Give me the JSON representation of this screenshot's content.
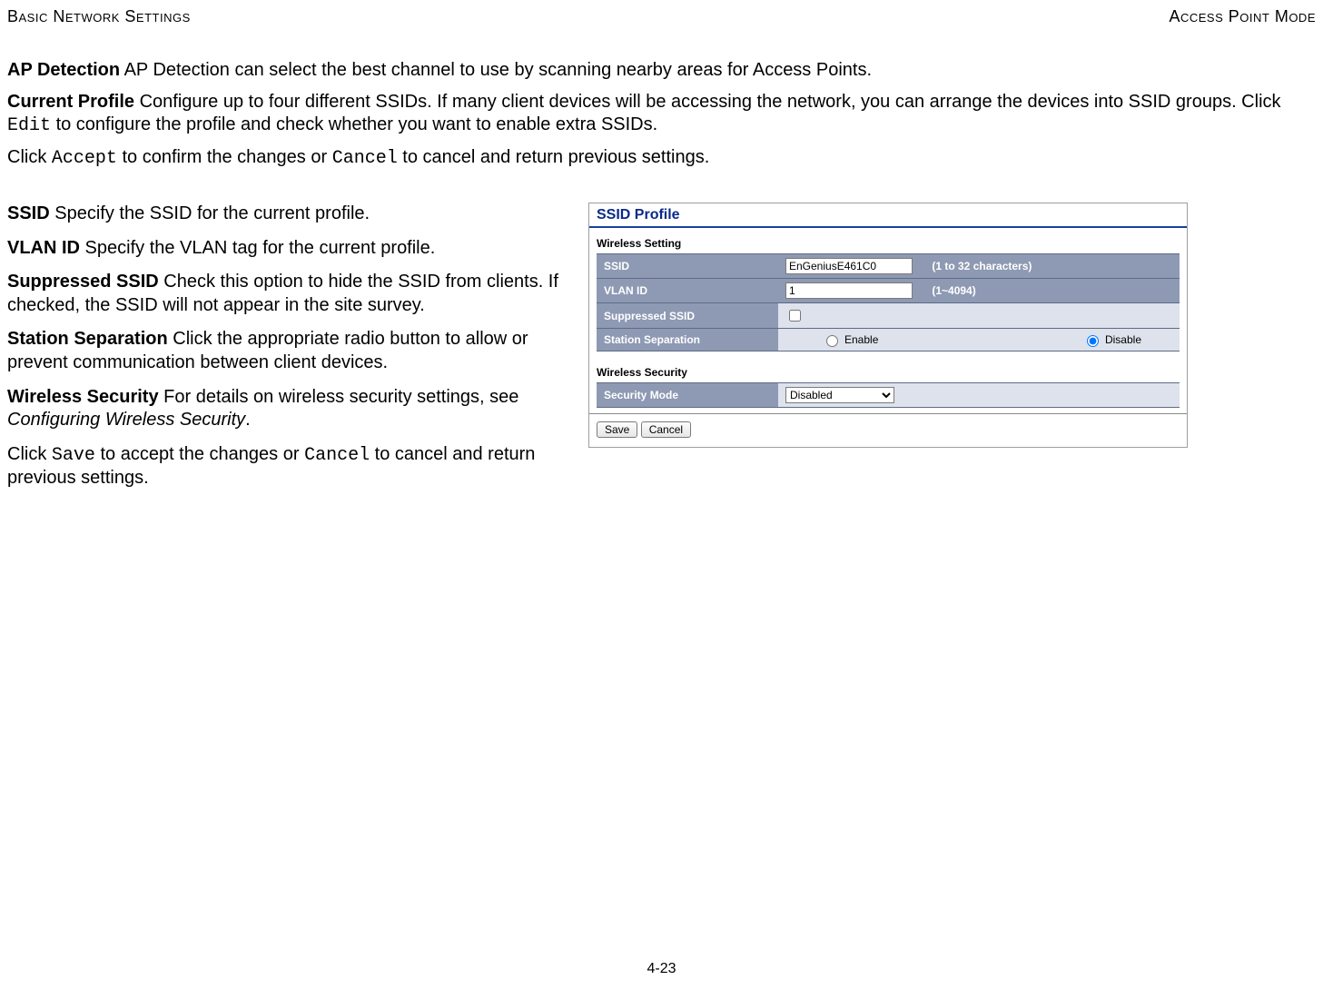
{
  "header": {
    "left": "Basic Network Settings",
    "right": "Access Point Mode"
  },
  "intro": {
    "ap_detection_label": "AP Detection",
    "ap_detection_text": "  AP Detection can select the best channel to use by scanning nearby areas for Access Points.",
    "current_profile_label": "Current Profile",
    "current_profile_text_a": "  Configure up to four different SSIDs. If many client devices will be accessing the network, you can arrange the devices into SSID groups. Click ",
    "edit_code": "Edit",
    "current_profile_text_b": " to configure the profile and check whether you want to enable extra SSIDs.",
    "click_a": "Click ",
    "accept_code": "Accept",
    "click_b": " to confirm the changes or ",
    "cancel_code": "Cancel",
    "click_c": " to cancel and return previous settings."
  },
  "left": {
    "ssid_label": "SSID",
    "ssid_text": "  Specify the SSID for the current profile.",
    "vlan_label": "VLAN ID",
    "vlan_text": "  Specify the VLAN tag for the current profile.",
    "supp_label": "Suppressed SSID",
    "supp_text": "  Check this option to hide the SSID from clients. If checked, the SSID will not appear in the site survey.",
    "sep_label": "Station Separation",
    "sep_text": "  Click the appropriate radio button to allow or prevent communication between client devices.",
    "sec_label": "Wireless Security",
    "sec_text_a": "  For details on wireless security settings, see ",
    "sec_text_italic": "Configuring Wireless Security",
    "sec_text_b": ".",
    "save_a": "Click ",
    "save_code": "Save",
    "save_b": " to accept the changes or ",
    "save_cancel_code": "Cancel",
    "save_c": " to cancel and return previous settings."
  },
  "shot": {
    "title": "SSID Profile",
    "wireless_setting": "Wireless Setting",
    "rows": {
      "ssid_label": "SSID",
      "ssid_value": "EnGeniusE461C0",
      "ssid_hint": "(1 to 32 characters)",
      "vlan_label": "VLAN ID",
      "vlan_value": "1",
      "vlan_hint": "(1~4094)",
      "supp_label": "Suppressed SSID",
      "sep_label": "Station Separation",
      "sep_enable": "Enable",
      "sep_disable": "Disable"
    },
    "wireless_security": "Wireless Security",
    "secmode_label": "Security Mode",
    "secmode_value": "Disabled",
    "save_btn": "Save",
    "cancel_btn": "Cancel"
  },
  "page_number": "4-23"
}
